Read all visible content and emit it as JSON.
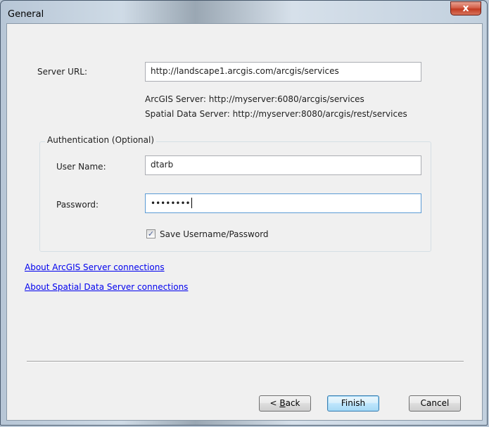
{
  "window": {
    "title": "General",
    "close_glyph": "x"
  },
  "server": {
    "url_label": "Server URL:",
    "url_value": "http://landscape1.arcgis.com/arcgis/services",
    "hint_arcgis": "ArcGIS Server: http://myserver:6080/arcgis/services",
    "hint_spatial": "Spatial Data Server: http://myserver:8080/arcgis/rest/services"
  },
  "auth": {
    "legend": "Authentication (Optional)",
    "username_label": "User Name:",
    "username_value": "dtarb",
    "password_label": "Password:",
    "password_mask": "••••••••",
    "save_label": "Save Username/Password",
    "save_checked": true
  },
  "links": {
    "arcgis": "About ArcGIS Server connections",
    "spatial": "About Spatial Data Server connections"
  },
  "buttons": {
    "back_prefix": "< ",
    "back_accel": "B",
    "back_rest": "ack",
    "finish": "Finish",
    "cancel": "Cancel"
  }
}
